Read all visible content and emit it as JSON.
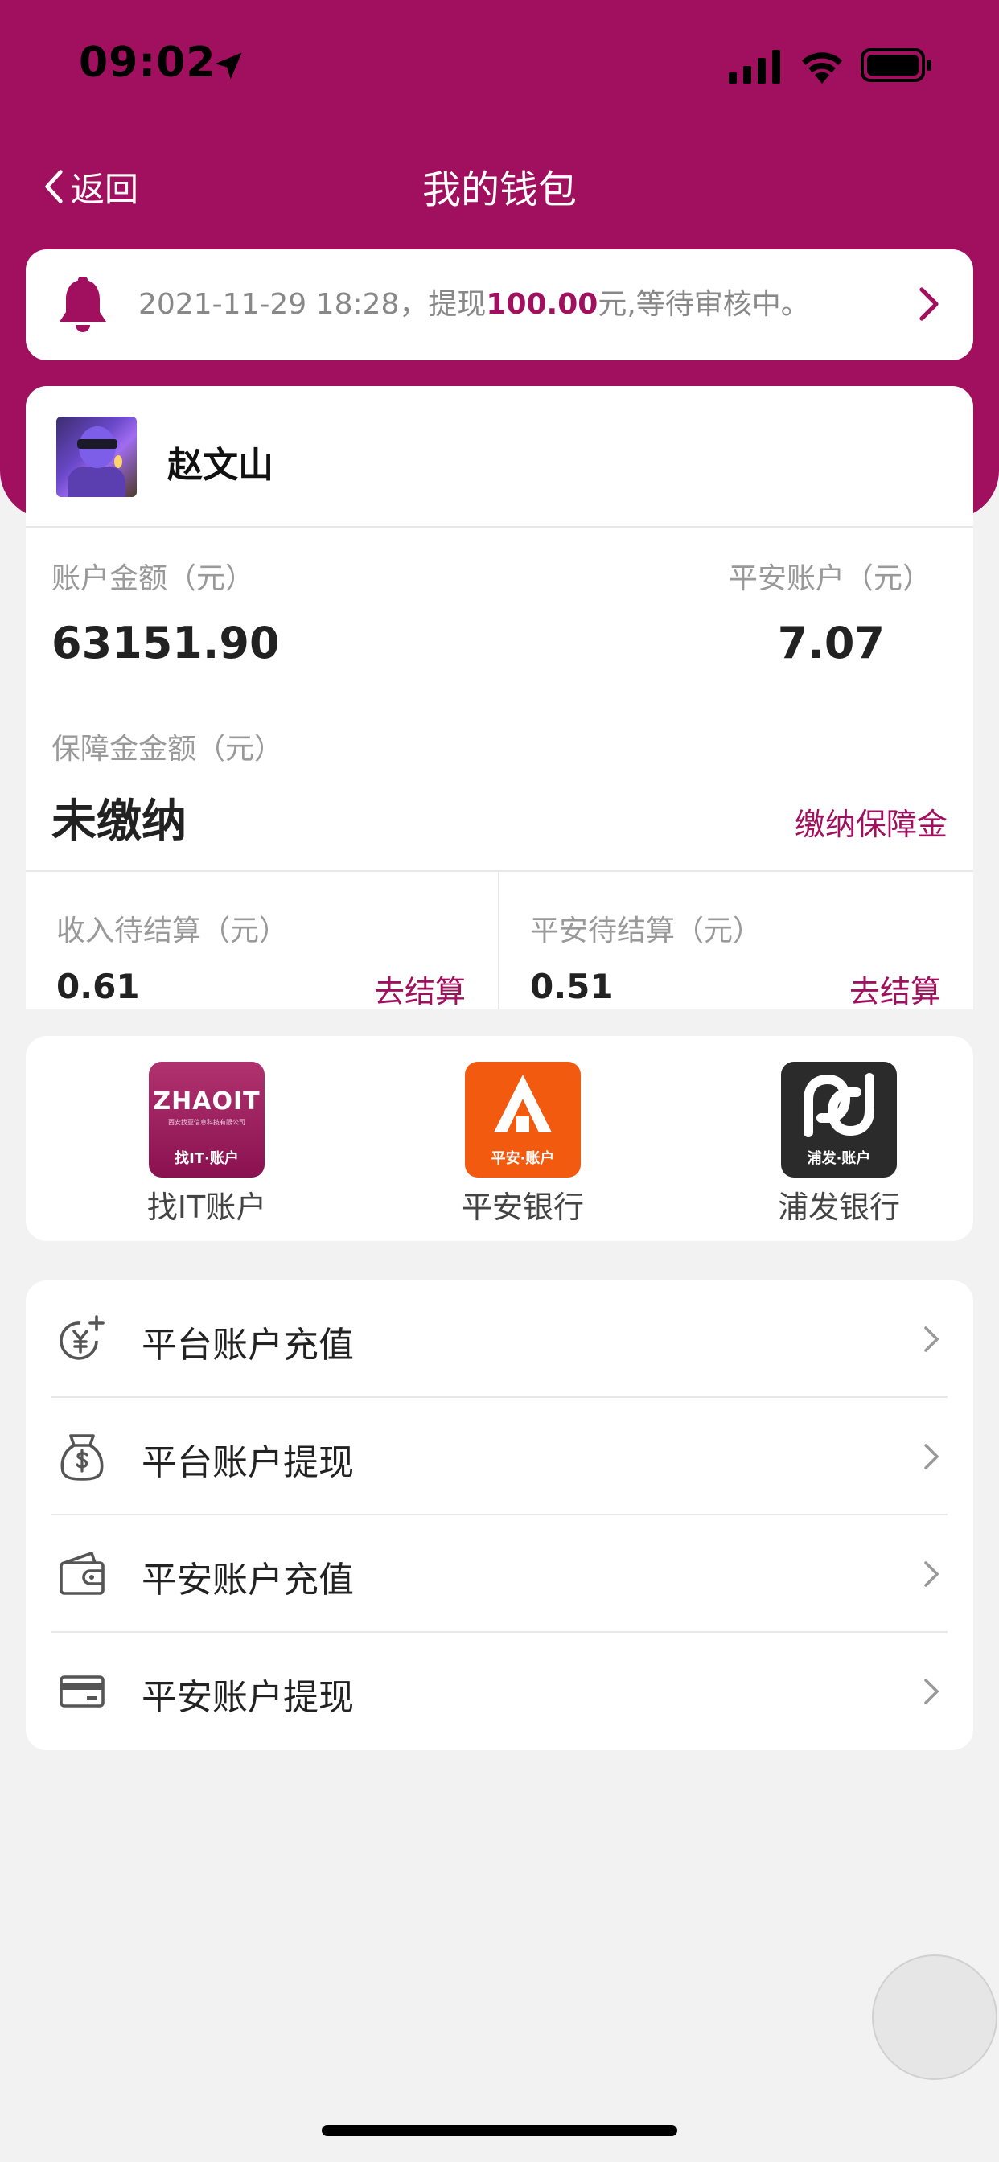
{
  "status_bar": {
    "time": "09:02"
  },
  "nav": {
    "back_label": "返回",
    "title": "我的钱包"
  },
  "notice": {
    "prefix": "2021-11-29 18:28，提现",
    "amount": "100.00",
    "suffix": "元,等待审核中。"
  },
  "user": {
    "name": "赵文山"
  },
  "balances": {
    "account_label": "账户金额（元）",
    "account_value": "63151.90",
    "pingan_label": "平安账户（元）",
    "pingan_value": "7.07",
    "deposit_label": "保障金金额（元）",
    "deposit_value": "未缴纳",
    "deposit_action": "缴纳保障金"
  },
  "settlement": {
    "income_label": "收入待结算（元）",
    "income_value": "0.61",
    "income_action": "去结算",
    "pingan_label": "平安待结算（元）",
    "pingan_value": "0.51",
    "pingan_action": "去结算"
  },
  "banks": [
    {
      "name": "找IT账户",
      "logo_text": "ZHAOIT",
      "logo_small": "西安找亚信息科技有限公司",
      "logo_sub": "找IT·账户"
    },
    {
      "name": "平安银行",
      "logo_sub": "平安·账户"
    },
    {
      "name": "浦发银行",
      "logo_sub": "浦发·账户"
    }
  ],
  "menu": [
    {
      "label": "平台账户充值",
      "icon": "yuan-coin-plus-icon"
    },
    {
      "label": "平台账户提现",
      "icon": "money-bag-icon"
    },
    {
      "label": "平安账户充值",
      "icon": "wallet-icon"
    },
    {
      "label": "平安账户提现",
      "icon": "credit-card-icon"
    }
  ],
  "colors": {
    "brand": "#a1105e",
    "background": "#f2f2f2",
    "pingan_orange": "#f25a0f",
    "spdb_dark": "#2b2b2b"
  }
}
